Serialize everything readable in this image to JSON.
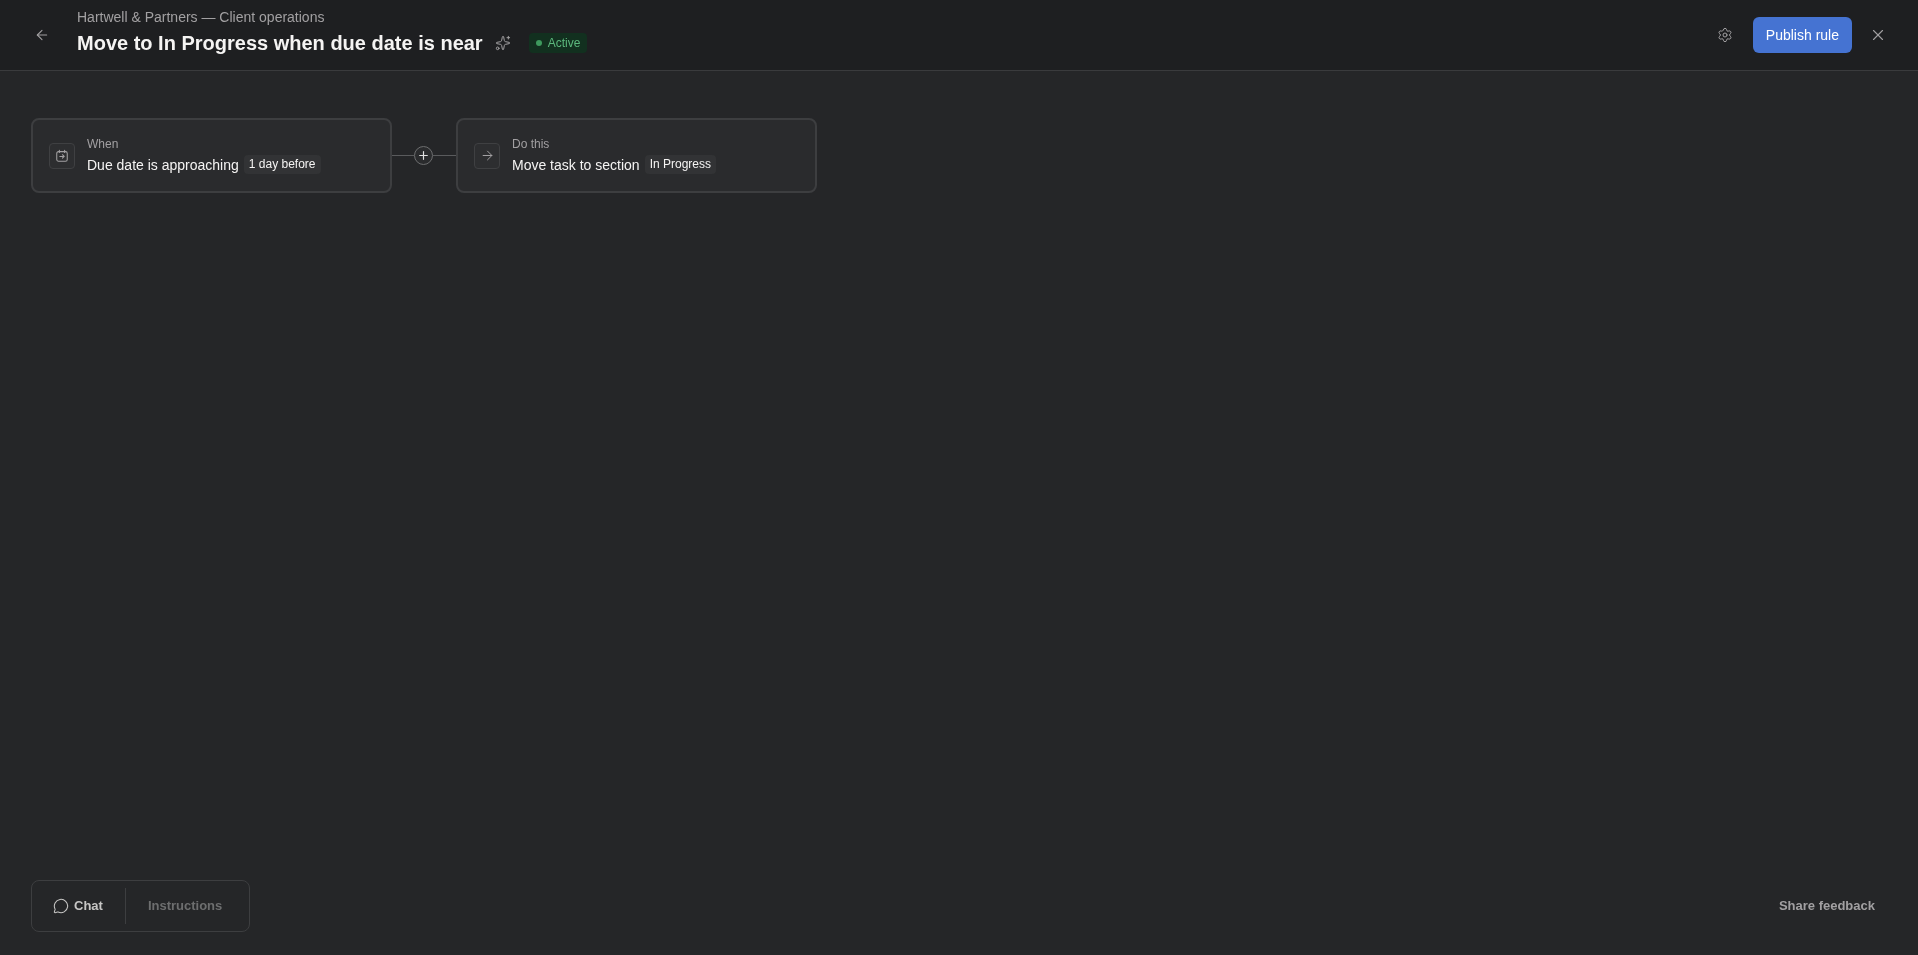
{
  "header": {
    "breadcrumb": "Hartwell & Partners — Client operations",
    "title": "Move to In Progress when due date is near",
    "status": {
      "label": "Active"
    },
    "publish_button": "Publish rule"
  },
  "flow": {
    "steps": [
      {
        "kind": "trigger",
        "heading": "When",
        "text": "Due date is approaching",
        "value": "1 day before"
      },
      {
        "kind": "action",
        "heading": "Do this",
        "text": "Move task to section",
        "value": "In Progress"
      }
    ]
  },
  "panel_tabs": [
    {
      "label": "Chat",
      "selected": true
    },
    {
      "label": "Instructions",
      "selected": false
    }
  ],
  "feedback_link": "Share feedback"
}
